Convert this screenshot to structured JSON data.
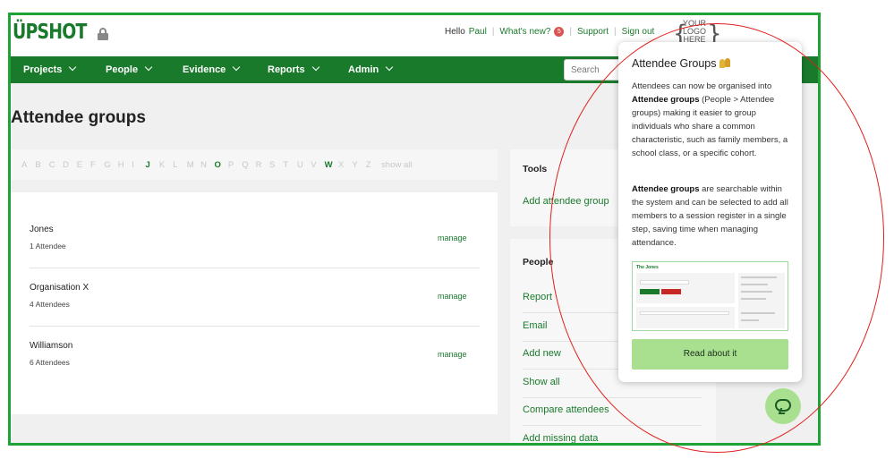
{
  "header": {
    "logo": "ÜPSHOT",
    "greeting": "Hello",
    "user_name": "Paul",
    "whats_new": "What's new?",
    "whats_new_count": "5",
    "support": "Support",
    "sign_out": "Sign out",
    "brand_placeholder": [
      "YOUR",
      "LOGO",
      "HERE"
    ]
  },
  "nav": {
    "items": [
      "Projects",
      "People",
      "Evidence",
      "Reports",
      "Admin"
    ],
    "search_placeholder": "Search"
  },
  "page_title": "Attendee groups",
  "alphabet": {
    "letters": [
      "A",
      "B",
      "C",
      "D",
      "E",
      "F",
      "G",
      "H",
      "I",
      "J",
      "K",
      "L",
      "M",
      "N",
      "O",
      "P",
      "Q",
      "R",
      "S",
      "T",
      "U",
      "V",
      "W",
      "X",
      "Y",
      "Z"
    ],
    "active": [
      "J",
      "O",
      "W"
    ],
    "show_all": "show all"
  },
  "groups": [
    {
      "name": "Jones",
      "count": "1 Attendee",
      "action": "manage"
    },
    {
      "name": "Organisation X",
      "count": "4 Attendees",
      "action": "manage"
    },
    {
      "name": "Williamson",
      "count": "6 Attendees",
      "action": "manage"
    }
  ],
  "tools": {
    "title": "Tools",
    "links": [
      "Add attendee group"
    ]
  },
  "people_panel": {
    "title": "People",
    "links": [
      "Report",
      "Email",
      "Add new",
      "Show all",
      "Compare attendees",
      "Add missing data"
    ]
  },
  "popup": {
    "title": "Attendee Groups",
    "p1_pre": "Attendees can now be organised into ",
    "p1_bold": "Attendee groups",
    "p1_post": " (People > Attendee groups) making it easier to group individuals who share a common characteristic, such as family members, a school class, or a specific cohort.",
    "p2_bold": "Attendee groups",
    "p2_post": " are searchable within the system and can be selected to add all members to a session register in a single step, saving time when managing attendance.",
    "thumb_title": "The Jones",
    "button": "Read about it"
  },
  "colors": {
    "brand_green": "#1a7a2c",
    "frame_green": "#1fa336",
    "button_green": "#a8e08f",
    "annotation_red": "#e0201c",
    "badge_red": "#d9534f"
  }
}
